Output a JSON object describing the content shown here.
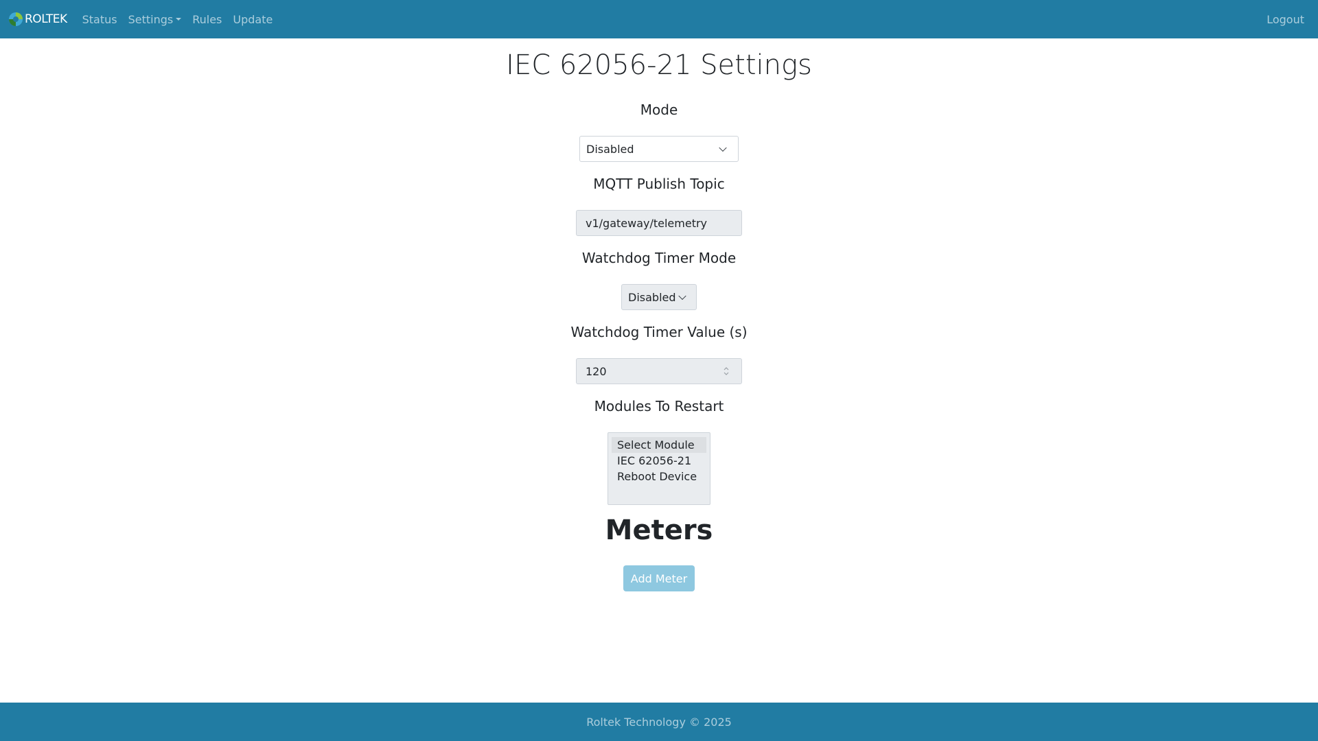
{
  "navbar": {
    "brand": "ROLTEK",
    "links": [
      "Status",
      "Settings",
      "Rules",
      "Update"
    ],
    "logout": "Logout"
  },
  "page": {
    "title": "IEC 62056-21 Settings"
  },
  "form": {
    "mode_label": "Mode",
    "mode_value": "Disabled",
    "mqtt_label": "MQTT Publish Topic",
    "mqtt_value": "v1/gateway/telemetry",
    "wdt_mode_label": "Watchdog Timer Mode",
    "wdt_mode_value": "Disabled",
    "wdt_value_label": "Watchdog Timer Value (s)",
    "wdt_value": "120",
    "modules_label": "Modules To Restart",
    "modules_options": [
      "Select Module",
      "IEC 62056-21",
      "Reboot Device"
    ]
  },
  "meters": {
    "title": "Meters",
    "add_button": "Add Meter"
  },
  "footer": {
    "text": "Roltek Technology © 2025"
  },
  "colors": {
    "navbar_bg": "#217ca3",
    "button_bg": "#8ec8e0"
  }
}
